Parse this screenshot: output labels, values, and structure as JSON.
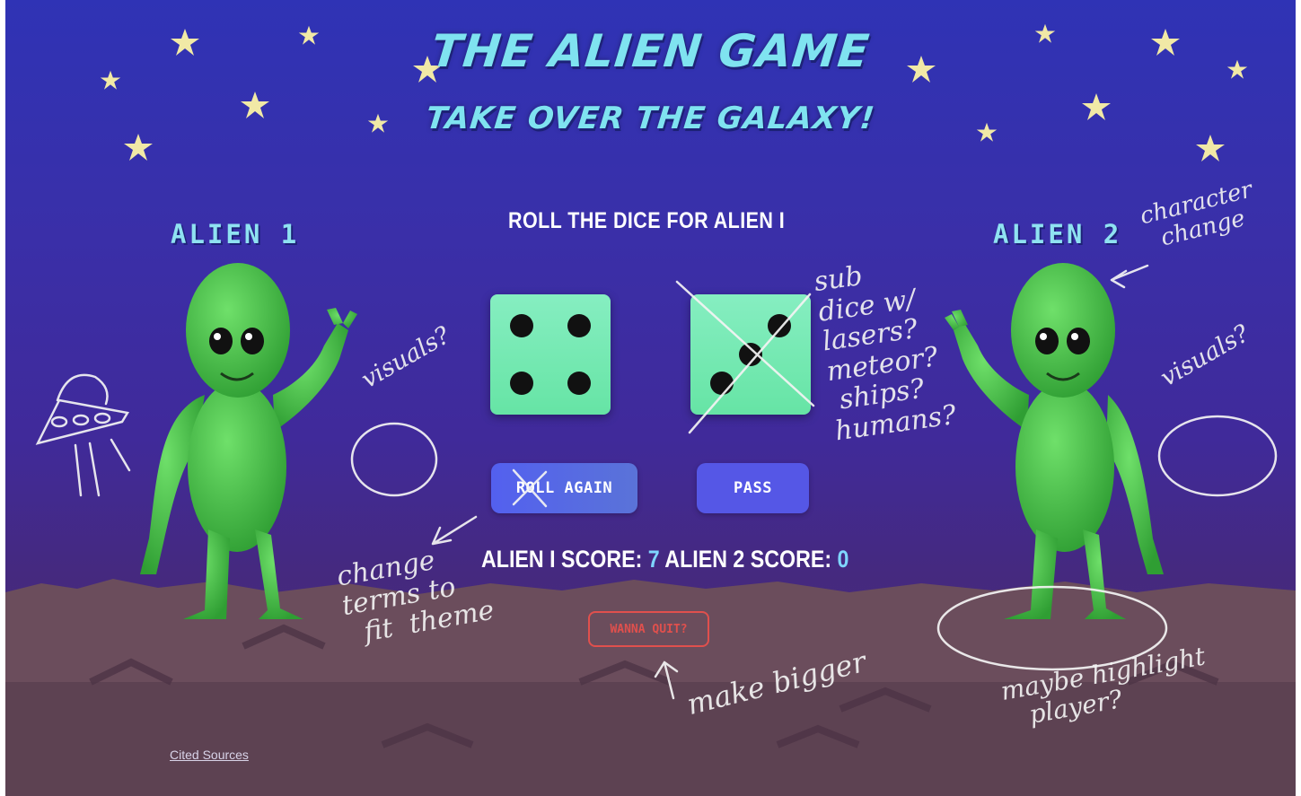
{
  "game": {
    "title": "THE ALIEN GAME",
    "subtitle": "TAKE OVER THE GALAXY!",
    "roll_prompt": "ROLL THE DICE FOR ALIEN I"
  },
  "players": [
    {
      "label": "ALIEN 1",
      "score_label": "ALIEN I SCORE:",
      "score": "7"
    },
    {
      "label": "ALIEN 2",
      "score_label": "ALIEN 2 SCORE:",
      "score": "0"
    }
  ],
  "dice": [
    {
      "value": 4
    },
    {
      "value": 3
    }
  ],
  "buttons": {
    "roll_again": "ROLL AGAIN",
    "pass": "PASS",
    "quit": "WANNA QUIT?"
  },
  "footer": {
    "cited_sources": "Cited Sources"
  },
  "annotations": {
    "character_change": "character\n  change",
    "visuals_left": "visuals?",
    "visuals_right": "visuals?",
    "sub_dice": "sub\ndice w/\nlasers?\nmeteor?\n ships?\nhumans?",
    "change_terms": "change\nterms to\n  fit  theme",
    "make_bigger": "make bigger",
    "highlight_player": "maybe highlight\n   player?"
  },
  "colors": {
    "sky_top": "#2f33b5",
    "title": "#7fe3f0",
    "dice": "#6be8ac",
    "buttons": "#5557e6",
    "quit": "#e0504d",
    "alien": "#3fbf3f"
  }
}
